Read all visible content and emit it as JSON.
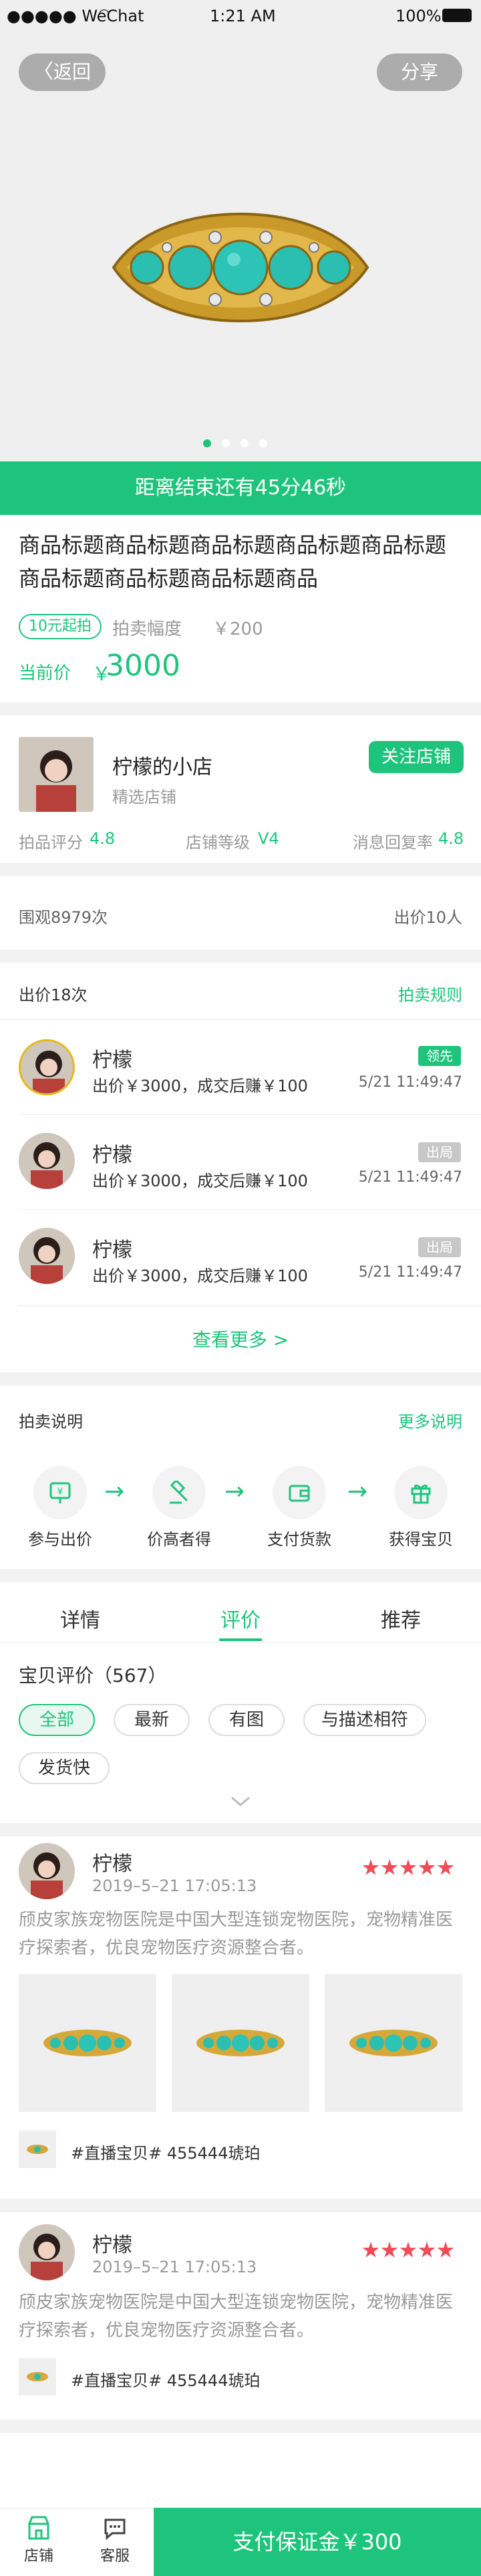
{
  "status_bar": {
    "carrier": "●●●●● WeChat",
    "time": "1:21 AM",
    "battery": "100%"
  },
  "hero": {
    "back_label": "返回",
    "share_label": "分享"
  },
  "countdown": "距离结束还有45分46秒",
  "product": {
    "title": "商品标题商品标题商品标题商品标题商品标题商品标题商品标题商品标题商品",
    "start_tag": "10元起拍",
    "increment_label": "拍卖幅度",
    "increment_value": "￥200",
    "current_label": "当前价",
    "currency": "￥",
    "current_price": "3000"
  },
  "shop": {
    "name": "柠檬的小店",
    "subtitle": "精选店铺",
    "follow_label": "关注店铺",
    "ratings": [
      {
        "label": "拍品评分",
        "value": "4.8"
      },
      {
        "label": "店铺等级",
        "value": "V4"
      },
      {
        "label": "消息回复率",
        "value": "4.8"
      }
    ]
  },
  "stats": {
    "views": "围观8979次",
    "bidders": "出价10人"
  },
  "bids": {
    "title": "出价18次",
    "rules_link": "拍卖规则",
    "items": [
      {
        "name": "柠檬",
        "desc": "出价￥3000，成交后赚￥100",
        "time": "5/21 11:49:47",
        "badge": "领先",
        "badge_color": "#1ec47c"
      },
      {
        "name": "柠檬",
        "desc": "出价￥3000，成交后赚￥100",
        "time": "5/21 11:49:47",
        "badge": "出局",
        "badge_color": "#c8c8c8"
      },
      {
        "name": "柠檬",
        "desc": "出价￥3000，成交后赚￥100",
        "time": "5/21 11:49:47",
        "badge": "出局",
        "badge_color": "#c8c8c8"
      }
    ],
    "more_label": "查看更多 >"
  },
  "guide": {
    "title": "拍卖说明",
    "more_link": "更多说明",
    "steps": [
      {
        "label": "参与出价",
        "icon": "price-tag-icon"
      },
      {
        "label": "价高者得",
        "icon": "gavel-icon"
      },
      {
        "label": "支付货款",
        "icon": "wallet-icon"
      },
      {
        "label": "获得宝贝",
        "icon": "gift-icon"
      }
    ]
  },
  "tabs": [
    {
      "label": "详情",
      "active": false
    },
    {
      "label": "评价",
      "active": true
    },
    {
      "label": "推荐",
      "active": false
    }
  ],
  "reviews": {
    "title": "宝贝评价（567）",
    "filters": [
      "全部",
      "最新",
      "有图",
      "与描述相符",
      "发货快"
    ],
    "items": [
      {
        "name": "柠檬",
        "date": "2019–5–21 17:05:13",
        "text": "颀皮家族宠物医院是中国大型连锁宠物医院，宠物精准医疗探索者，优良宠物医疗资源整合者。",
        "tag": "#直播宝贝# 455444琥珀",
        "stars": 5
      },
      {
        "name": "柠檬",
        "date": "2019–5–21 17:05:13",
        "text": "颀皮家族宠物医院是中国大型连锁宠物医院，宠物精准医疗探索者，优良宠物医疗资源整合者。",
        "tag": "#直播宝贝# 455444琥珀",
        "stars": 5
      }
    ]
  },
  "bottom_bar": {
    "store_label": "店铺",
    "service_label": "客服",
    "pay_label": "支付保证金￥300"
  },
  "colors": {
    "accent": "#1ec47c",
    "star": "#f04b58",
    "leading_badge": "#1ec47c",
    "out_badge": "#c8c8c8"
  }
}
